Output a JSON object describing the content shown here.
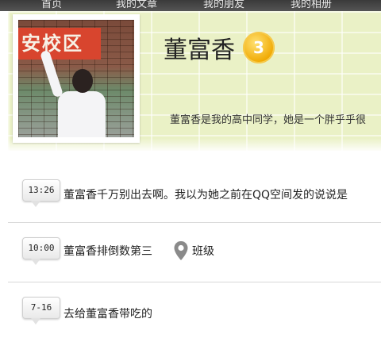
{
  "nav": {
    "items": [
      "首页",
      "我的文章",
      "我的朋友",
      "我的相册"
    ]
  },
  "profile": {
    "name": "董富香",
    "level": "3",
    "bio": "董富香是我的高中同学，她是一个胖乎乎很",
    "avatar_banner_text": "安校区"
  },
  "posts": [
    {
      "time": "13:26",
      "text": "董富香千万别出去啊。我以为她之前在QQ空间发的说说是"
    },
    {
      "time": "10:00",
      "text": "董富香排倒数第三",
      "location": "班级",
      "location_icon": "map-pin-icon"
    },
    {
      "time": "7-16",
      "text": "去给董富香带吃的"
    }
  ],
  "colors": {
    "header_bg": "#eaf1c6",
    "badge": "#f0a800",
    "pin": "#8a8a8a"
  }
}
